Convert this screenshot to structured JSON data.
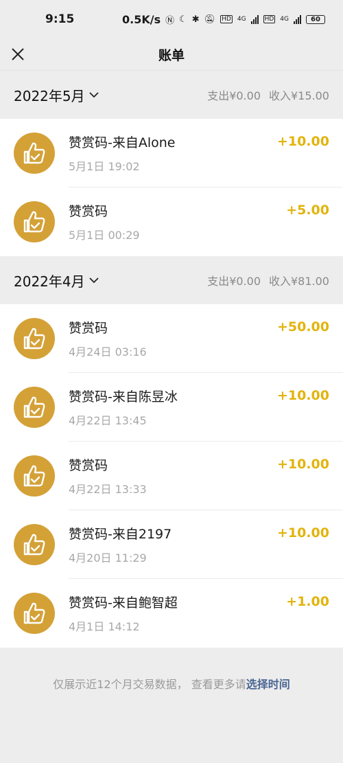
{
  "status": {
    "time": "9:15",
    "net_speed": "0.5K/s",
    "net_label_1": "4G",
    "net_label_2": "4G",
    "battery": "60"
  },
  "header": {
    "title": "账单"
  },
  "months": [
    {
      "label": "2022年5月",
      "expense": "支出¥0.00",
      "income": "收入¥15.00",
      "items": [
        {
          "name": "赞赏码-来自Alone",
          "time": "5月1日 19:02",
          "amount": "+10.00"
        },
        {
          "name": "赞赏码",
          "time": "5月1日 00:29",
          "amount": "+5.00"
        }
      ]
    },
    {
      "label": "2022年4月",
      "expense": "支出¥0.00",
      "income": "收入¥81.00",
      "items": [
        {
          "name": "赞赏码",
          "time": "4月24日 03:16",
          "amount": "+50.00"
        },
        {
          "name": "赞赏码-来自陈昱冰",
          "time": "4月22日 13:45",
          "amount": "+10.00"
        },
        {
          "name": "赞赏码",
          "time": "4月22日 13:33",
          "amount": "+10.00"
        },
        {
          "name": "赞赏码-来自2197",
          "time": "4月20日 11:29",
          "amount": "+10.00"
        },
        {
          "name": "赞赏码-来自鲍智超",
          "time": "4月1日 14:12",
          "amount": "+1.00"
        }
      ]
    }
  ],
  "footer": {
    "text": "仅展示近12个月交易数据， 查看更多请",
    "link": "选择时间"
  },
  "colors": {
    "accent_amount": "#e2b40c",
    "avatar_bg": "#d4a137",
    "link": "#4a6592"
  }
}
